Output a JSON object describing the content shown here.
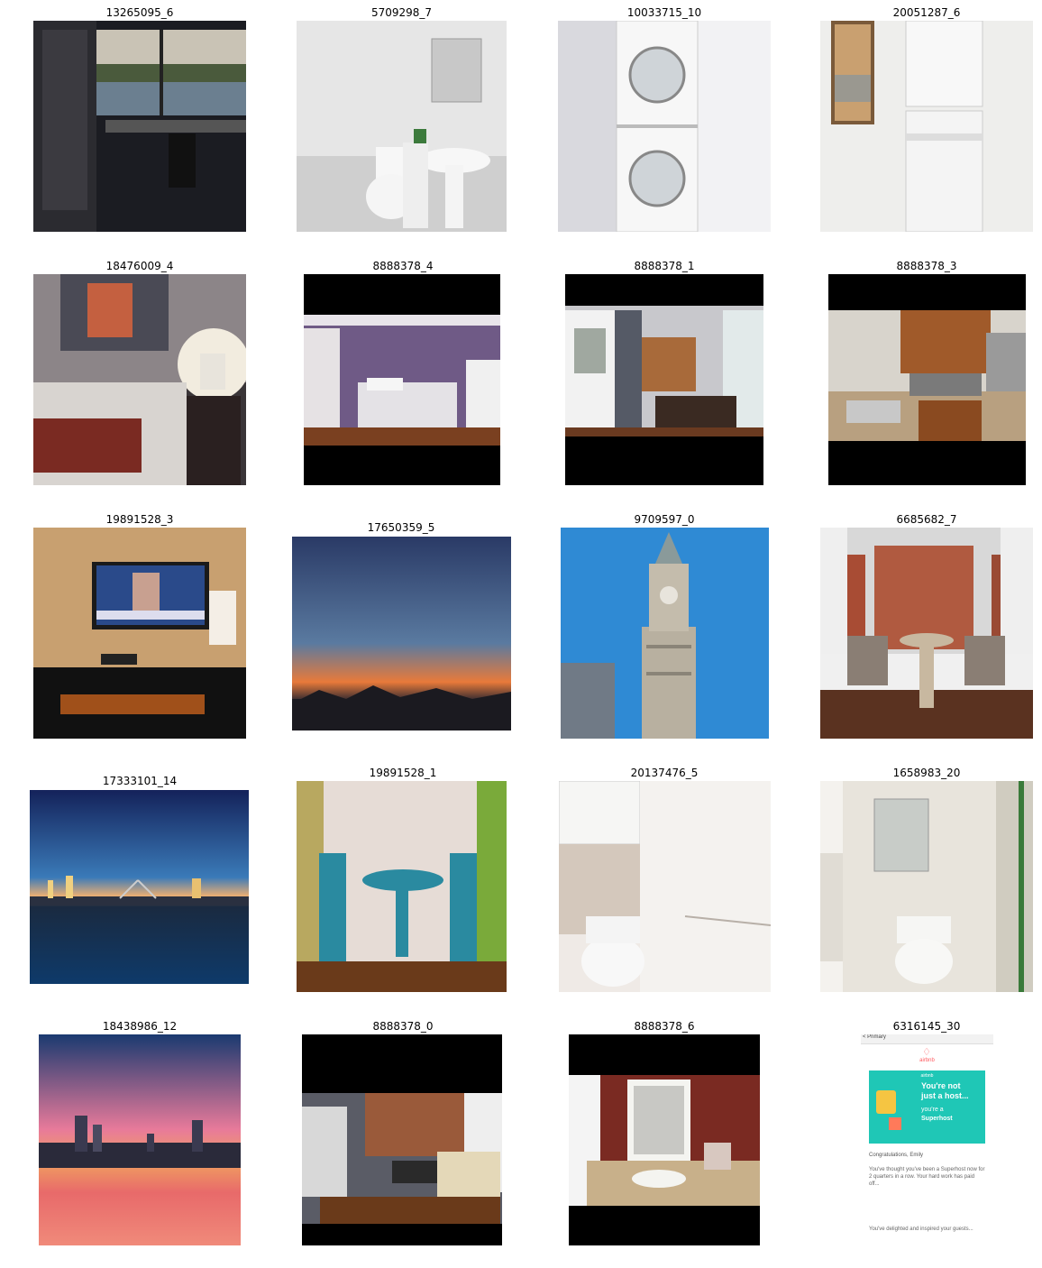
{
  "grid": {
    "tiles": [
      {
        "caption": "13265095_6"
      },
      {
        "caption": "5709298_7"
      },
      {
        "caption": "10033715_10"
      },
      {
        "caption": "20051287_6"
      },
      {
        "caption": "18476009_4"
      },
      {
        "caption": "8888378_4"
      },
      {
        "caption": "8888378_1"
      },
      {
        "caption": "8888378_3"
      },
      {
        "caption": "19891528_3"
      },
      {
        "caption": "17650359_5"
      },
      {
        "caption": "9709597_0"
      },
      {
        "caption": "6685682_7"
      },
      {
        "caption": "17333101_14"
      },
      {
        "caption": "19891528_1"
      },
      {
        "caption": "20137476_5"
      },
      {
        "caption": "1658983_20"
      },
      {
        "caption": "18438986_12"
      },
      {
        "caption": "8888378_0"
      },
      {
        "caption": "8888378_6"
      },
      {
        "caption": "6316145_30"
      }
    ]
  },
  "screenshot_tile": {
    "top_bar": "< Primary",
    "brand": "airbnb",
    "banner_brand": "airbnb",
    "banner_line1": "You're not",
    "banner_line2": "just a host...",
    "banner_line3": "you're a",
    "banner_line4": "Superhost",
    "greeting": "Congratulations, Emily",
    "body1": "You've thought you've been a Superhost now for 2 quarters in a row. Your hard work has paid off...",
    "body2": "You've delighted and inspired your guests..."
  }
}
